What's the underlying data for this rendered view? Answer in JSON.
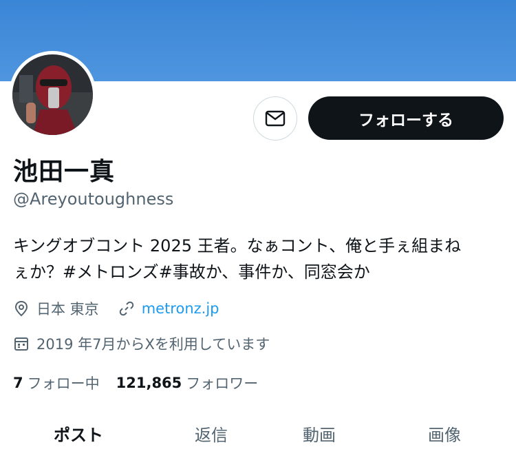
{
  "colors": {
    "banner": "#4a8fdc",
    "accent_link": "#1d9bf0",
    "follow_button_bg": "#0f1419",
    "muted_text": "#536471"
  },
  "profile": {
    "display_name": "池田一真",
    "handle": "@Areyoutoughness",
    "bio_line1": "キングオブコント 2025 王者。なぁコント、俺と手ぇ組まね",
    "bio_line2": "ぇか？#メトロンズ#事故か、事件か、同窓会か",
    "location": "日本 東京",
    "website": "metronz.jp",
    "joined": "2019 年7月からXを利用しています"
  },
  "actions": {
    "message_icon": "envelope-icon",
    "follow_label": "フォローする"
  },
  "stats": {
    "following_count": "7",
    "following_label": "フォロー中",
    "followers_count": "121,865",
    "followers_label": "フォロワー"
  },
  "tabs": [
    {
      "label": "ポスト",
      "active": true
    },
    {
      "label": "返信",
      "active": false
    },
    {
      "label": "動画",
      "active": false
    },
    {
      "label": "画像",
      "active": false
    }
  ]
}
